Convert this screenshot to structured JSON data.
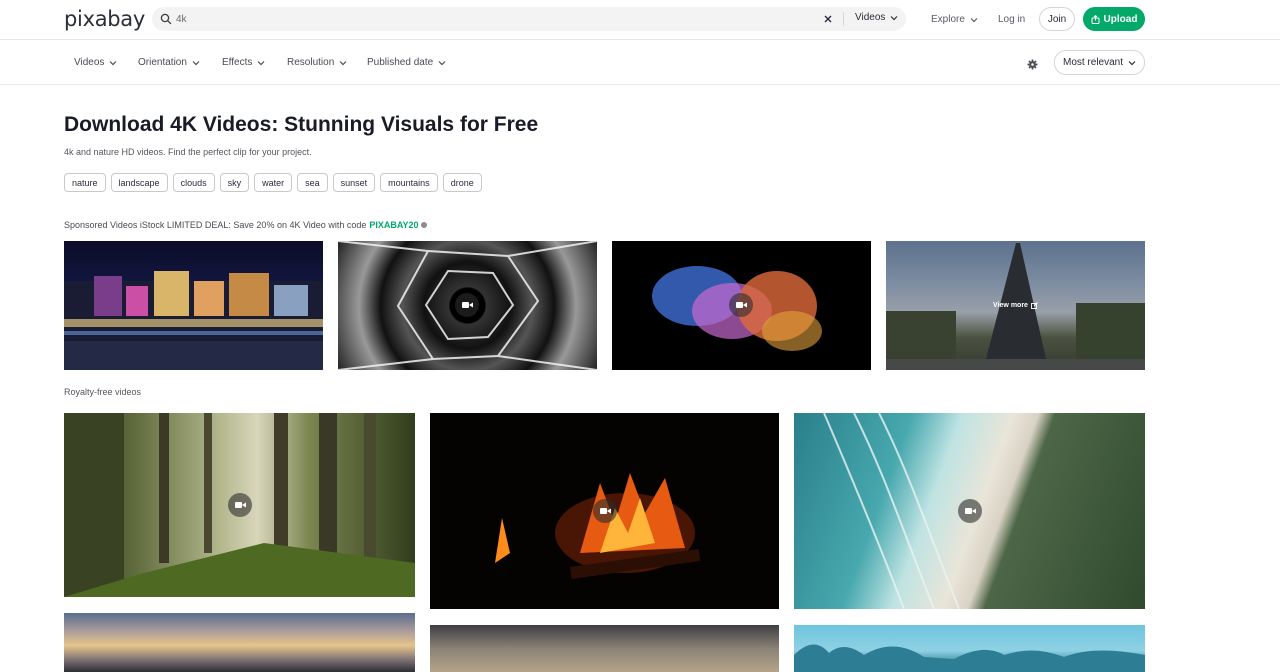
{
  "header": {
    "logo": "pixabay",
    "search_value": "4k",
    "search_type": "Videos",
    "explore": "Explore",
    "login": "Log in",
    "join": "Join",
    "upload": "Upload"
  },
  "filters": {
    "items": [
      "Videos",
      "Orientation",
      "Effects",
      "Resolution",
      "Published date"
    ],
    "sort": "Most relevant"
  },
  "hero": {
    "title": "Download 4K Videos: Stunning Visuals for Free",
    "subtitle": "4k and nature HD videos. Find the perfect clip for your project.",
    "tags": [
      "nature",
      "landscape",
      "clouds",
      "sky",
      "water",
      "sea",
      "sunset",
      "mountains",
      "drone"
    ]
  },
  "sponsored": {
    "text": "Sponsored Videos iStock LIMITED DEAL: Save 20% on 4K Video with code",
    "code": "PIXABAY20",
    "view_more": "View more"
  },
  "royalty_label": "Royalty-free videos",
  "colors": {
    "accent": "#02a969",
    "text": "#191b26",
    "border": "#e6e6e6"
  }
}
